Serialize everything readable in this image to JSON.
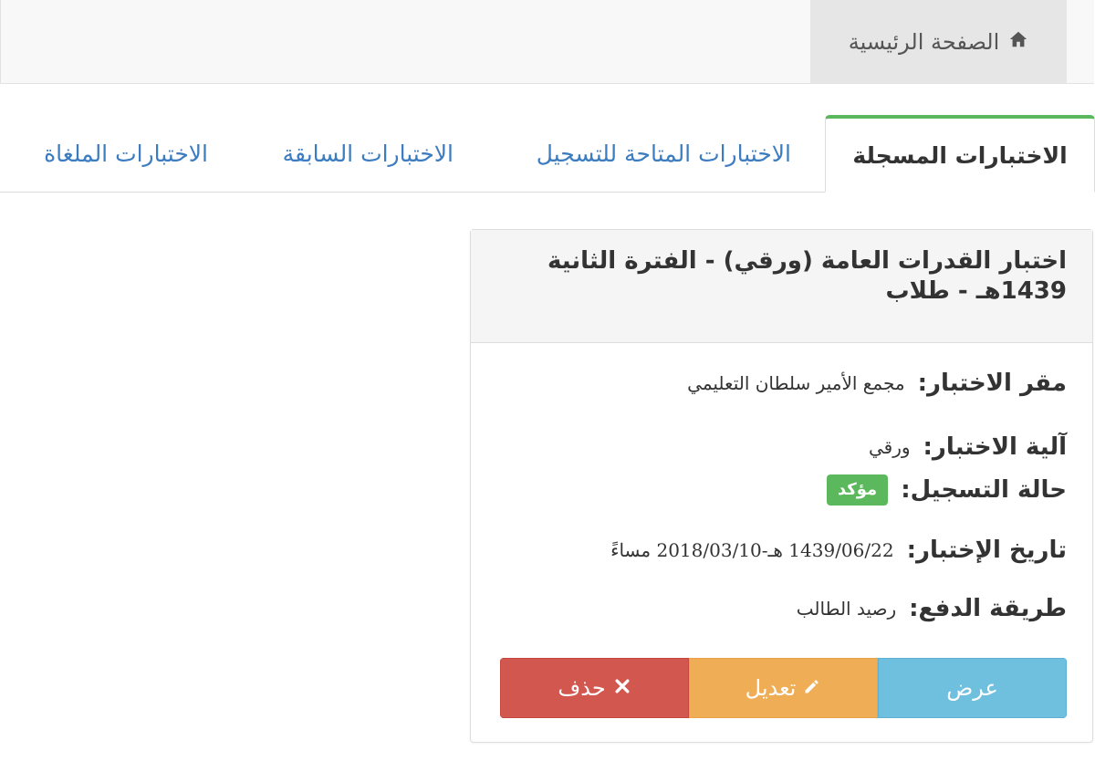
{
  "nav": {
    "home_label": "الصفحة الرئيسية",
    "home_icon": "home-icon"
  },
  "tabs": [
    {
      "label": "الاختبارات المسجلة",
      "active": true
    },
    {
      "label": "الاختبارات المتاحة للتسجيل",
      "active": false
    },
    {
      "label": "الاختبارات السابقة",
      "active": false
    },
    {
      "label": "الاختبارات الملغاة",
      "active": false
    }
  ],
  "exam": {
    "title_line1": "اختبار القدرات العامة (ورقي) - الفترة الثانية",
    "title_line2": "1439هـ - طلاب",
    "location_label": "مقر الاختبار:",
    "location_value": "مجمع الأمير سلطان التعليمي",
    "mode_label": "آلية الاختبار:",
    "mode_value": "ورقي",
    "status_label": "حالة التسجيل:",
    "status_value": "مؤكد",
    "date_label": "تاريخ الإختبار:",
    "date_value": "1439/06/22 هـ-2018/03/10 مساءً",
    "payment_label": "طريقة الدفع:",
    "payment_value": "رصيد الطالب"
  },
  "actions": {
    "view_label": "عرض",
    "edit_label": "تعديل",
    "edit_icon": "pencil-icon",
    "delete_label": "حذف",
    "delete_icon": "close-icon"
  },
  "colors": {
    "accent_green": "#5cb85c",
    "view": "#6fbfdf",
    "edit": "#efad55",
    "delete": "#d2574f",
    "link": "#3c7cc0"
  }
}
